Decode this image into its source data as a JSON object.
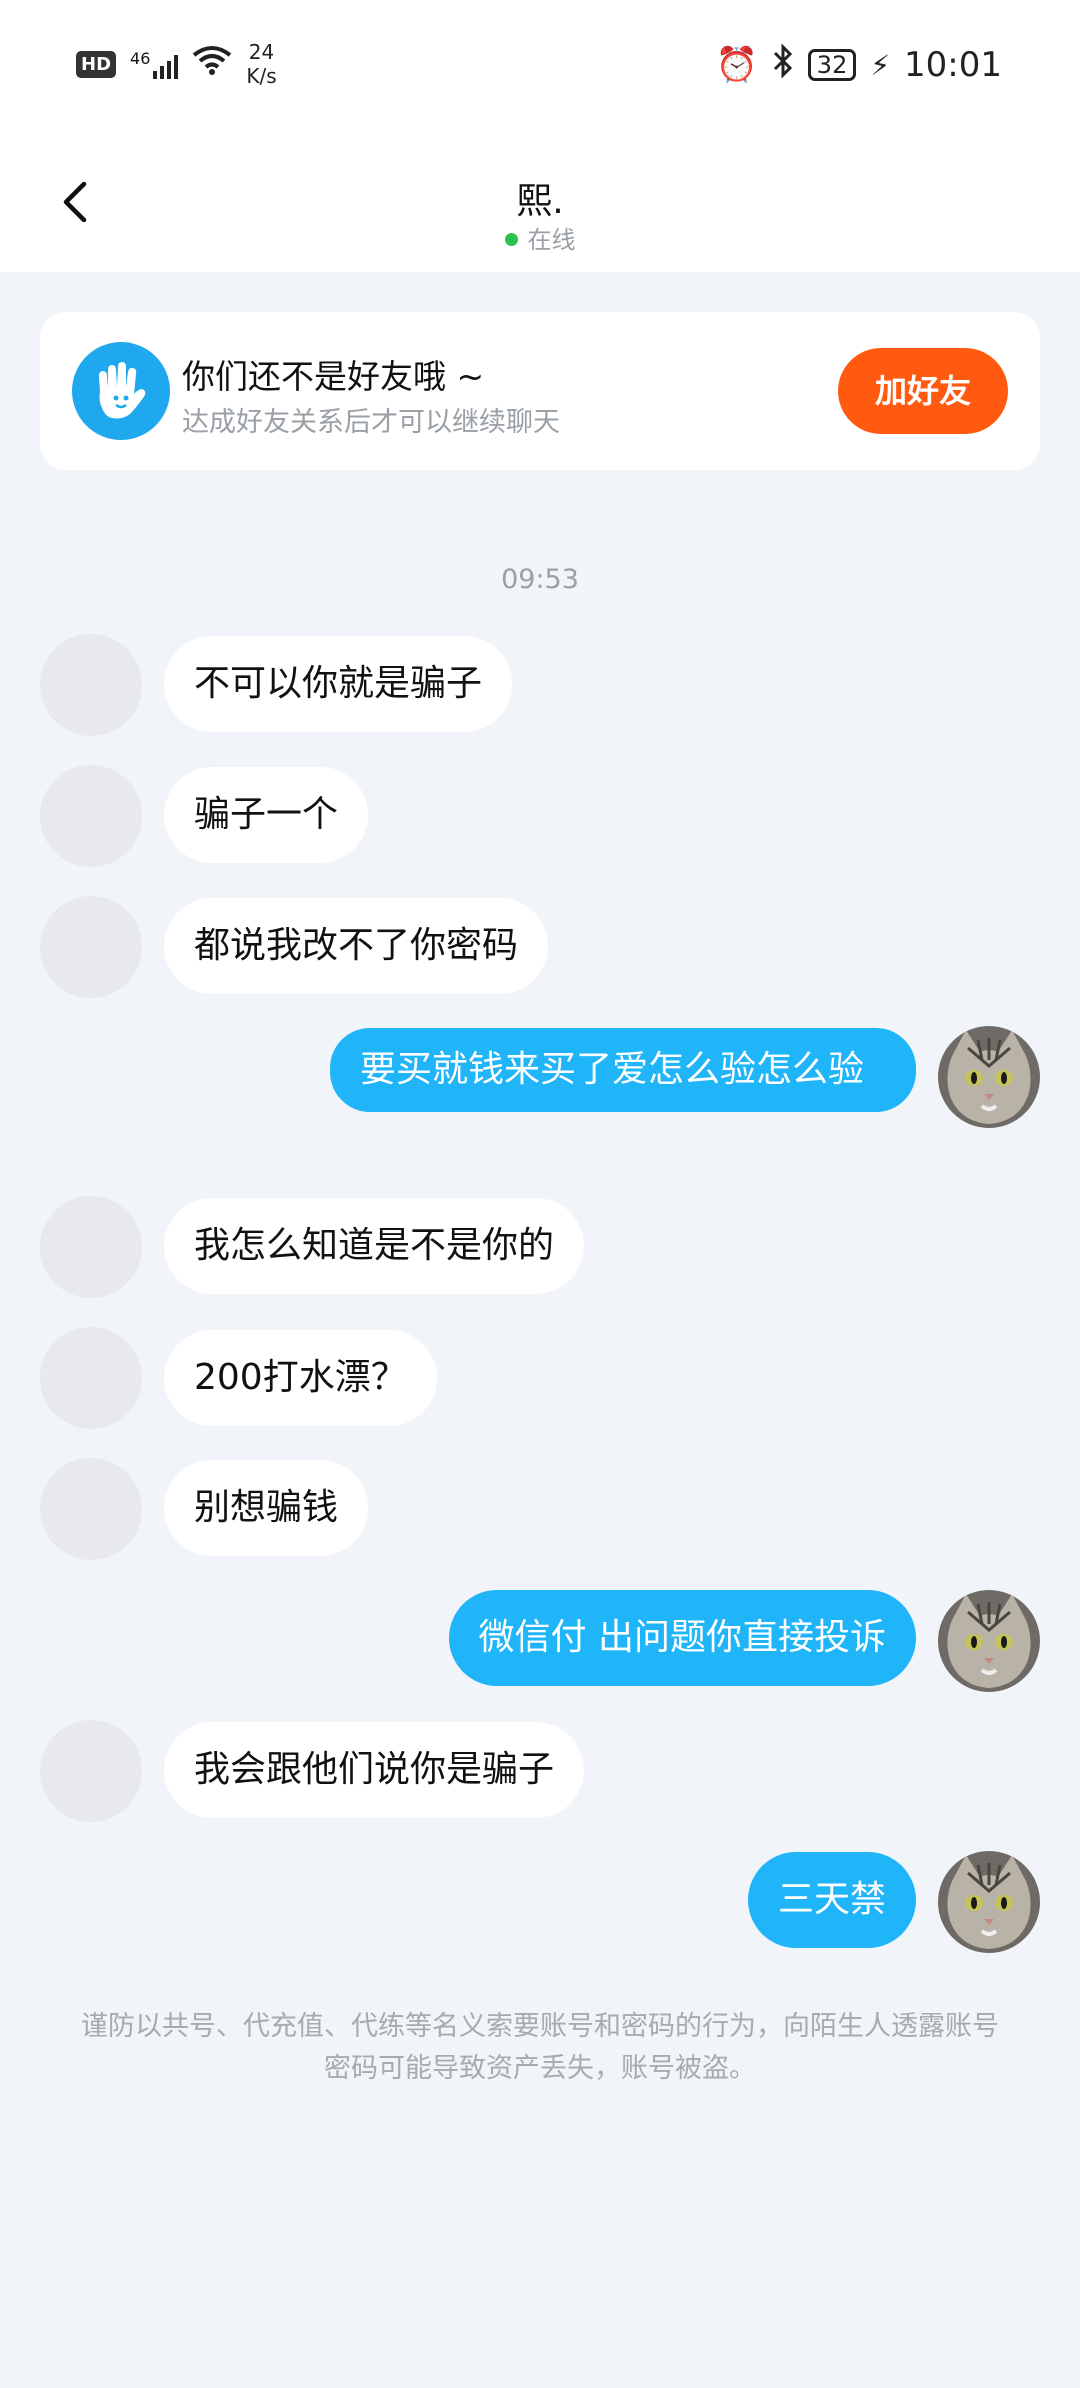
{
  "status_bar": {
    "hd": "HD",
    "network": "46",
    "speed_value": "24",
    "speed_unit": "K/s",
    "battery": "32",
    "time": "10:01"
  },
  "header": {
    "title": "熙.",
    "status": "在线"
  },
  "friend_card": {
    "title": "你们还不是好友哦 ~",
    "subtitle": "达成好友关系后才可以继续聊天",
    "button": "加好友"
  },
  "timestamp": "09:53",
  "messages": [
    {
      "side": "in",
      "text": "不可以你就是骗子"
    },
    {
      "side": "in",
      "text": "骗子一个"
    },
    {
      "side": "in",
      "text": "都说我改不了你密码"
    },
    {
      "side": "out",
      "text": "要买就钱来买了爱怎么验怎么验"
    },
    {
      "side": "in",
      "text": "我怎么知道是不是你的"
    },
    {
      "side": "in",
      "text": "200打水漂？"
    },
    {
      "side": "in",
      "text": "别想骗钱"
    },
    {
      "side": "out",
      "text": "微信付  出问题你直接投诉"
    },
    {
      "side": "in",
      "text": "我会跟他们说你是骗子"
    },
    {
      "side": "out",
      "text": "三天禁"
    }
  ],
  "disclaimer": "谨防以共号、代充值、代练等名义索要账号和密码的行为，向陌生人透露账号密码可能导致资产丢失，账号被盗。",
  "colors": {
    "background": "#f1f4f8",
    "outgoing_bubble": "#1fb5f8",
    "add_button": "#ff5a10",
    "online": "#29c24a"
  }
}
